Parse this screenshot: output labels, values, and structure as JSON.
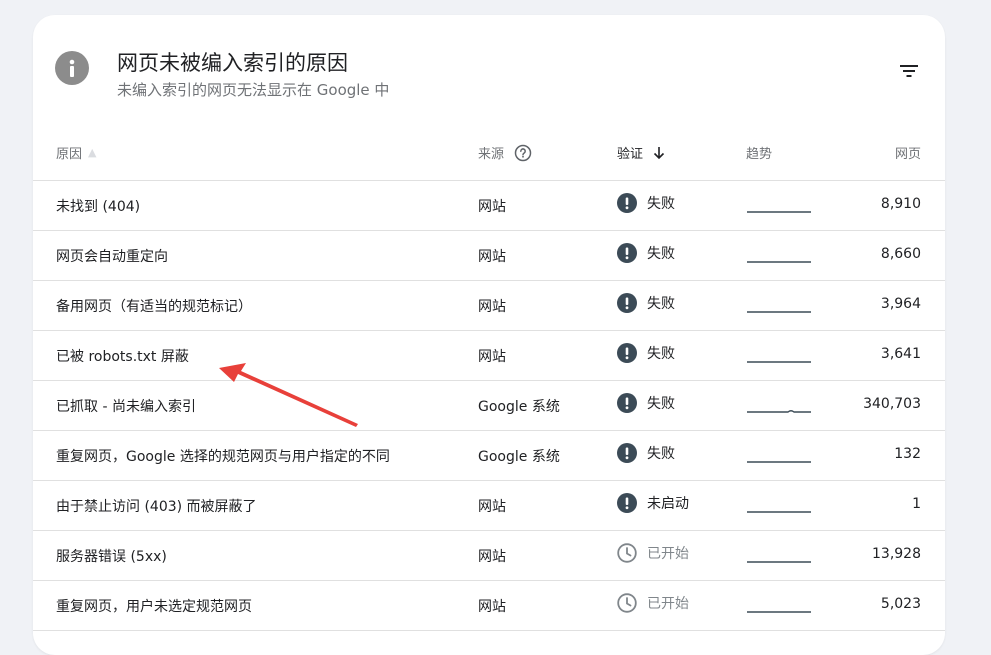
{
  "header": {
    "title": "网页未被编入索引的原因",
    "subtitle": "未编入索引的网页无法显示在 Google 中"
  },
  "table": {
    "columns": {
      "reason": "原因",
      "source": "来源",
      "verification": "验证",
      "trend": "趋势",
      "pages": "网页"
    },
    "rows": [
      {
        "reason": "未找到 (404)",
        "source": "网站",
        "status": "失败",
        "status_type": "fail",
        "pages": "8,910",
        "trend": "flat"
      },
      {
        "reason": "网页会自动重定向",
        "source": "网站",
        "status": "失败",
        "status_type": "fail",
        "pages": "8,660",
        "trend": "flat"
      },
      {
        "reason": "备用网页（有适当的规范标记）",
        "source": "网站",
        "status": "失败",
        "status_type": "fail",
        "pages": "3,964",
        "trend": "flat"
      },
      {
        "reason": "已被 robots.txt 屏蔽",
        "source": "网站",
        "status": "失败",
        "status_type": "fail",
        "pages": "3,641",
        "trend": "flat"
      },
      {
        "reason": "已抓取 - 尚未编入索引",
        "source": "Google 系统",
        "status": "失败",
        "status_type": "fail",
        "pages": "340,703",
        "trend": "bump"
      },
      {
        "reason": "重复网页，Google 选择的规范网页与用户指定的不同",
        "source": "Google 系统",
        "status": "失败",
        "status_type": "fail",
        "pages": "132",
        "trend": "flat"
      },
      {
        "reason": "由于禁止访问 (403) 而被屏蔽了",
        "source": "网站",
        "status": "未启动",
        "status_type": "fail",
        "pages": "1",
        "trend": "flat"
      },
      {
        "reason": "服务器错误 (5xx)",
        "source": "网站",
        "status": "已开始",
        "status_type": "started",
        "pages": "13,928",
        "trend": "flat"
      },
      {
        "reason": "重复网页，用户未选定规范网页",
        "source": "网站",
        "status": "已开始",
        "status_type": "started",
        "pages": "5,023",
        "trend": "flat"
      }
    ]
  },
  "colors": {
    "fail_icon": "#3c4b57",
    "started_icon": "#80868b",
    "annotation_arrow": "#e8403a"
  },
  "icons": {
    "header": "info-icon",
    "filter": "filter-icon",
    "source_help": "help-circle-icon",
    "sort": "arrow-down-icon",
    "fail": "exclamation-circle-icon",
    "started": "clock-icon"
  }
}
